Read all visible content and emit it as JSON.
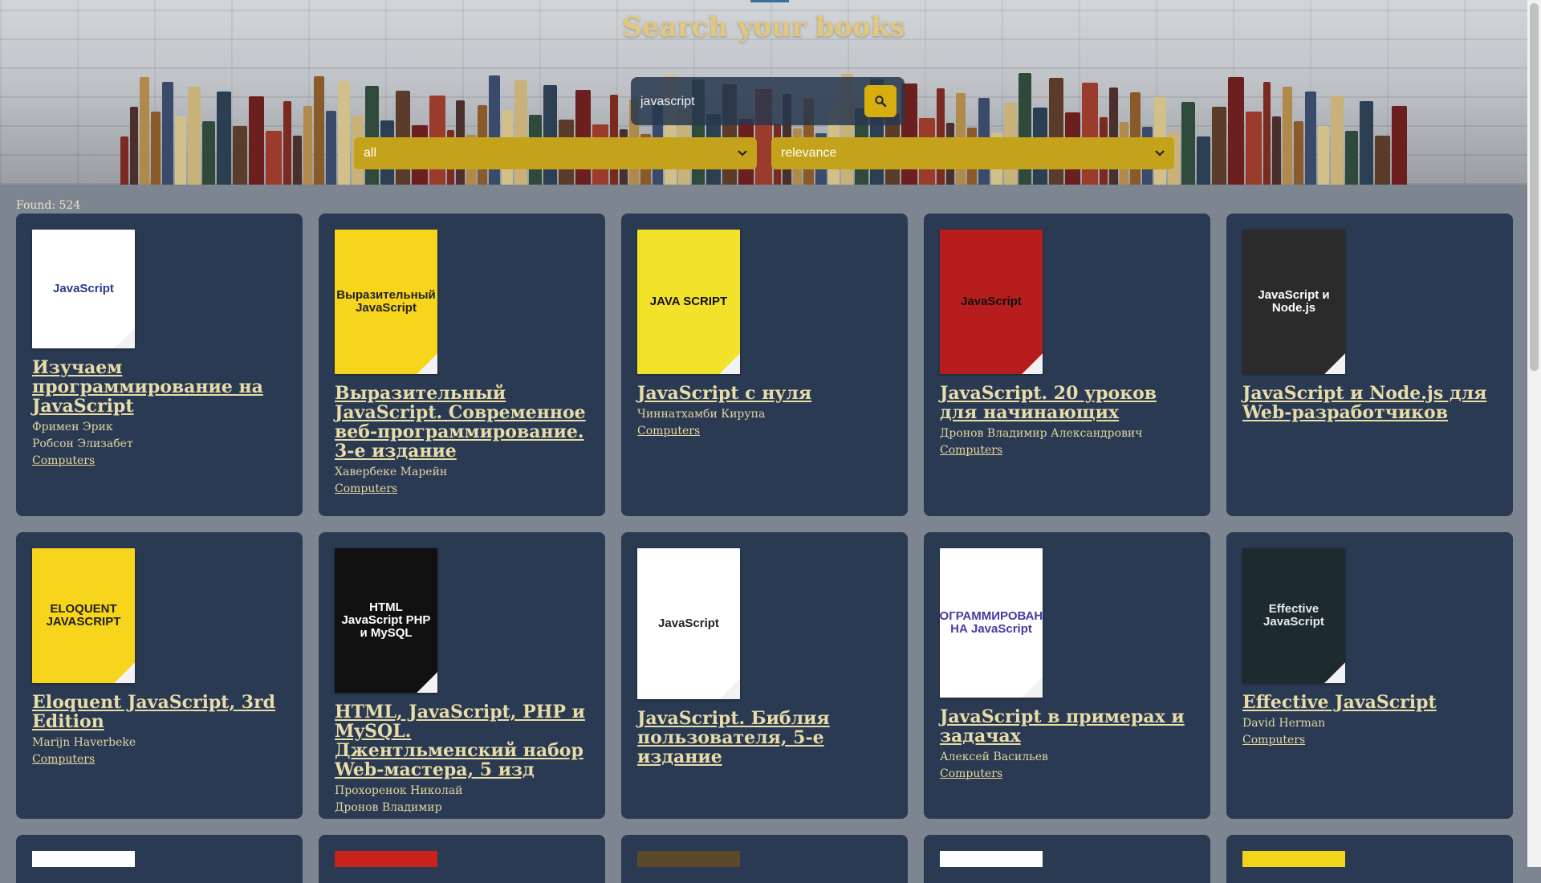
{
  "header": {
    "title": "Search your books"
  },
  "search": {
    "value": "javascript",
    "button_icon": "search-icon"
  },
  "filters": {
    "category": {
      "selected": "all"
    },
    "sort": {
      "selected": "relevance"
    }
  },
  "results": {
    "found_label": "Found: 524",
    "books": [
      {
        "title": "Изучаем программирование на JavaScript",
        "authors": [
          "Фримен Эрик",
          "Робсон Элизабет"
        ],
        "category": "Computers",
        "cover": {
          "bg": "#ffffff",
          "fg": "#2b3a8a",
          "text": "JavaScript"
        }
      },
      {
        "title": "Выразительный JavaScript. Современное веб-программирование. 3-е издание",
        "authors": [
          "Хавербеке Марейн"
        ],
        "category": "Computers",
        "cover": {
          "bg": "#f6d51c",
          "fg": "#222222",
          "text": "Выразительный JavaScript"
        }
      },
      {
        "title": "JavaScript с нуля",
        "authors": [
          "Чиннатхамби Кирупа"
        ],
        "category": "Computers",
        "cover": {
          "bg": "#f3e22a",
          "fg": "#111111",
          "text": "JAVA SCRIPT"
        }
      },
      {
        "title": "JavaScript. 20 уроков для начинающих",
        "authors": [
          "Дронов Владимир Александрович"
        ],
        "category": "Computers",
        "cover": {
          "bg": "#b81d1d",
          "fg": "#111111",
          "text": "JavaScript"
        }
      },
      {
        "title": "JavaScript и Node.js для Web-разработчиков",
        "authors": [],
        "category": "",
        "cover": {
          "bg": "#2b2b2b",
          "fg": "#ffffff",
          "text": "JavaScript и Node.js"
        }
      },
      {
        "title": "Eloquent JavaScript, 3rd Edition",
        "authors": [
          "Marijn Haverbeke"
        ],
        "category": "Computers",
        "cover": {
          "bg": "#f6d51c",
          "fg": "#222222",
          "text": "ELOQUENT JAVASCRIPT"
        }
      },
      {
        "title": "HTML, JavaScript, PHP и MySQL. Джентльменский набор Web-мастера, 5 изд",
        "authors": [
          "Прохоренок Николай",
          "Дронов Владимир"
        ],
        "category": "",
        "cover": {
          "bg": "#111111",
          "fg": "#ffffff",
          "text": "HTML JavaScript PHP и MySQL"
        }
      },
      {
        "title": "JavaScript. Библия пользователя, 5-е издание",
        "authors": [],
        "category": "",
        "cover": {
          "bg": "#ffffff",
          "fg": "#222222",
          "text": "JavaScript"
        }
      },
      {
        "title": "JavaScript в примерах и задачах",
        "authors": [
          "Алексей Васильев"
        ],
        "category": "Computers",
        "cover": {
          "bg": "#ffffff",
          "fg": "#4a3aa0",
          "text": "ПРОГРАММИРОВАНИЕ НА JavaScript"
        }
      },
      {
        "title": "Effective JavaScript",
        "authors": [
          "David Herman"
        ],
        "category": "Computers",
        "cover": {
          "bg": "#1d2a30",
          "fg": "#e8e8e8",
          "text": "Effective JavaScript"
        }
      }
    ],
    "partial_row_covers": [
      "#ffffff",
      "#c8221c",
      "#5a4a2a",
      "#ffffff",
      "#f2d21a"
    ]
  }
}
